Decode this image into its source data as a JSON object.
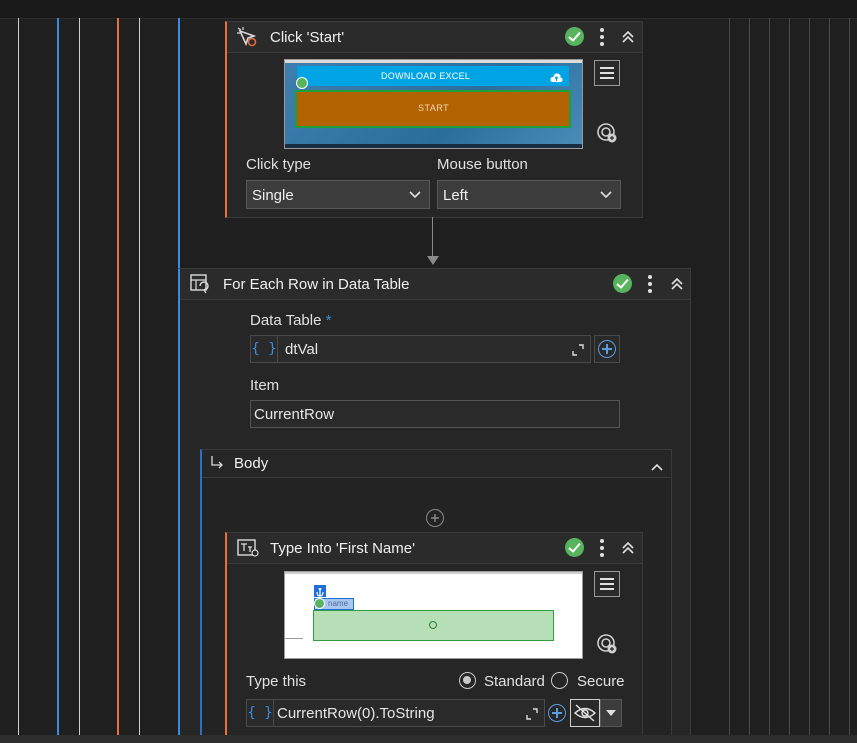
{
  "colors": {
    "accent_orange": "#e8703a",
    "accent_blue": "#3a8be0",
    "success_green": "#58b35e",
    "thumb_blue": "#00a4e4",
    "thumb_brown": "#b36200"
  },
  "click_activity": {
    "title": "Click 'Start'",
    "icon": "click-icon",
    "thumbnail": {
      "download_label": "DOWNLOAD EXCEL",
      "start_label": "START"
    },
    "click_type_label": "Click type",
    "click_type_value": "Single",
    "mouse_button_label": "Mouse button",
    "mouse_button_value": "Left"
  },
  "for_each": {
    "title": "For Each Row in Data Table",
    "icon": "for-each-icon",
    "data_table_label": "Data Table",
    "required_mark": "*",
    "data_table_value": "dtVal",
    "item_label": "Item",
    "item_value": "CurrentRow",
    "body_label": "Body"
  },
  "type_into": {
    "title": "Type Into 'First Name'",
    "icon": "type-into-icon",
    "thumbnail": {
      "hint": "name"
    },
    "type_this_label": "Type this",
    "standard_label": "Standard",
    "secure_label": "Secure",
    "mode_selected": "Standard",
    "type_this_value": "CurrentRow(0).ToString"
  }
}
